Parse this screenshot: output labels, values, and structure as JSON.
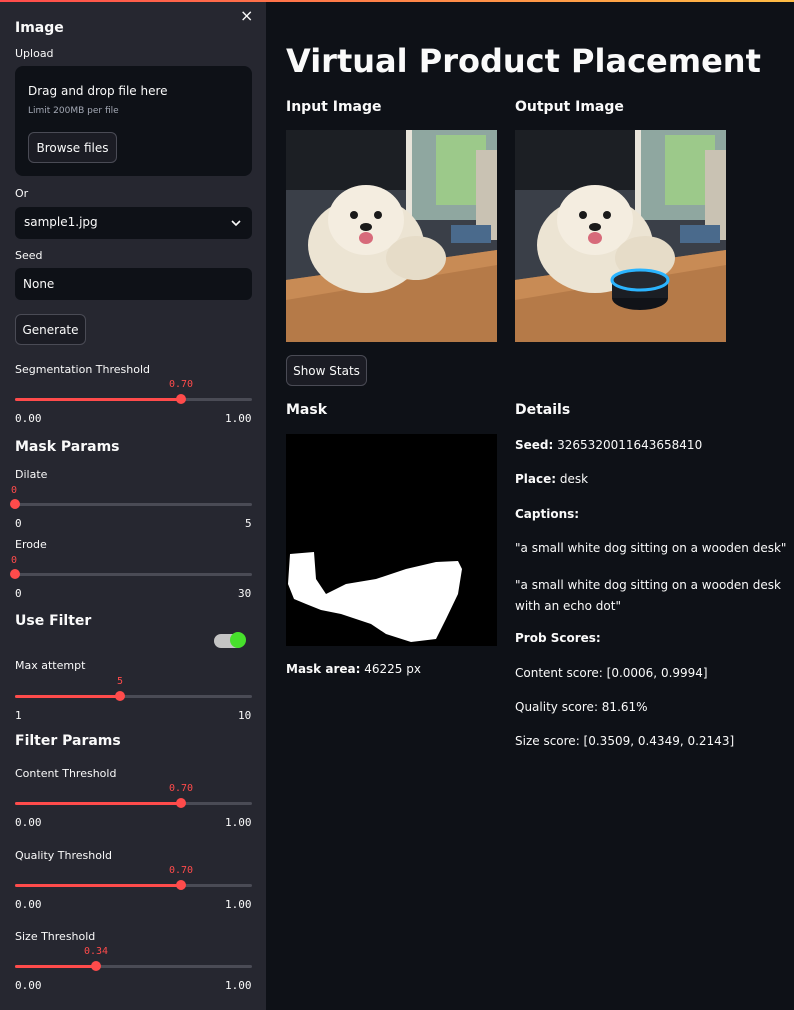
{
  "sidebar": {
    "title": "Image",
    "close": "×",
    "upload": {
      "label": "Upload",
      "drop_text": "Drag and drop file here",
      "limit_text": "Limit 200MB per file",
      "browse": "Browse files"
    },
    "or_label": "Or",
    "select": {
      "value": "sample1.jpg"
    },
    "seed": {
      "label": "Seed",
      "value": "None"
    },
    "generate": "Generate",
    "seg_threshold": {
      "label": "Segmentation Threshold",
      "value": "0.70",
      "min": "0.00",
      "max": "1.00",
      "fraction": 0.7
    },
    "mask_params": {
      "title": "Mask Params",
      "dilate": {
        "label": "Dilate",
        "value": "0",
        "min": "0",
        "max": "5",
        "fraction": 0.0
      },
      "erode": {
        "label": "Erode",
        "value": "0",
        "min": "0",
        "max": "30",
        "fraction": 0.0
      }
    },
    "use_filter": {
      "label": "Use Filter",
      "on": true
    },
    "max_attempt": {
      "label": "Max attempt",
      "value": "5",
      "min": "1",
      "max": "10",
      "fraction": 0.444
    },
    "filter_params": {
      "title": "Filter Params",
      "content": {
        "label": "Content Threshold",
        "value": "0.70",
        "min": "0.00",
        "max": "1.00",
        "fraction": 0.7
      },
      "quality": {
        "label": "Quality Threshold",
        "value": "0.70",
        "min": "0.00",
        "max": "1.00",
        "fraction": 0.7
      },
      "size": {
        "label": "Size Threshold",
        "value": "0.34",
        "min": "0.00",
        "max": "1.00",
        "fraction": 0.34
      }
    }
  },
  "main": {
    "title": "Virtual Product Placement",
    "input_image_label": "Input Image",
    "output_image_label": "Output Image",
    "show_stats": "Show Stats",
    "mask_label": "Mask",
    "mask_area_label": "Mask area:",
    "mask_area_value": "46225 px",
    "details": {
      "title": "Details",
      "seed_label": "Seed:",
      "seed_value": "3265320011643658410",
      "place_label": "Place:",
      "place_value": "desk",
      "captions_label": "Captions:",
      "caption1": "\"a small white dog sitting on a wooden desk\"",
      "caption2": "\"a small white dog sitting on a wooden desk with an echo dot\"",
      "prob_label": "Prob Scores:",
      "content_score": "Content score: [0.0006, 0.9994]",
      "quality_score": "Quality score: 81.61%",
      "size_score": "Size score: [0.3509, 0.4349, 0.2143]"
    }
  },
  "colors": {
    "accent": "#ff4b4b",
    "sidebar_bg": "#262730",
    "main_bg": "#0e1117",
    "toggle_on": "#47e02c"
  }
}
